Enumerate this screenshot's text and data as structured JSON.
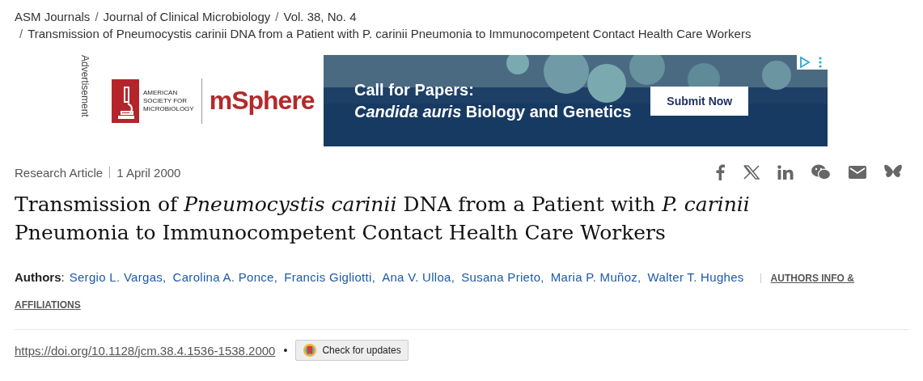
{
  "breadcrumbs": [
    "ASM Journals",
    "Journal of Clinical Microbiology",
    "Vol. 38, No. 4",
    "Transmission of Pneumocystis carinii DNA from a Patient with P. carinii Pneumonia to Immunocompetent Contact Health Care Workers"
  ],
  "breadcrumb_separator": "/",
  "advertisement": {
    "label": "Advertisement",
    "society_lines": [
      "AMERICAN",
      "SOCIETY FOR",
      "MICROBIOLOGY"
    ],
    "journal_logo": "mSphere",
    "headline": "Call for Papers:",
    "subline": "*Candida auris* Biology and Genetics",
    "button": "Submit Now"
  },
  "article": {
    "type": "Research Article",
    "date": "1 April 2000",
    "title": "Transmission of *Pneumocystis carinii* DNA from a Patient with *P. carinii* Pneumonia to Immunocompetent Contact Health Care Workers",
    "authors_label": "**Authors**:",
    "authors": [
      "Sergio L. Vargas,",
      "Carolina A. Ponce,",
      "Francis Gigliotti,",
      "Ana V. Ulloa,",
      "Susana Prieto,",
      "Maria P. Muñoz,",
      "Walter T. Hughes"
    ],
    "authors_info_link_lines": [
      "AUTHORS INFO &",
      "AFFILIATIONS"
    ],
    "doi": "https://doi.org/10.1128/jcm.38.4.1536-1538.2000",
    "bullet": "•",
    "updates_button": "Check for updates"
  }
}
